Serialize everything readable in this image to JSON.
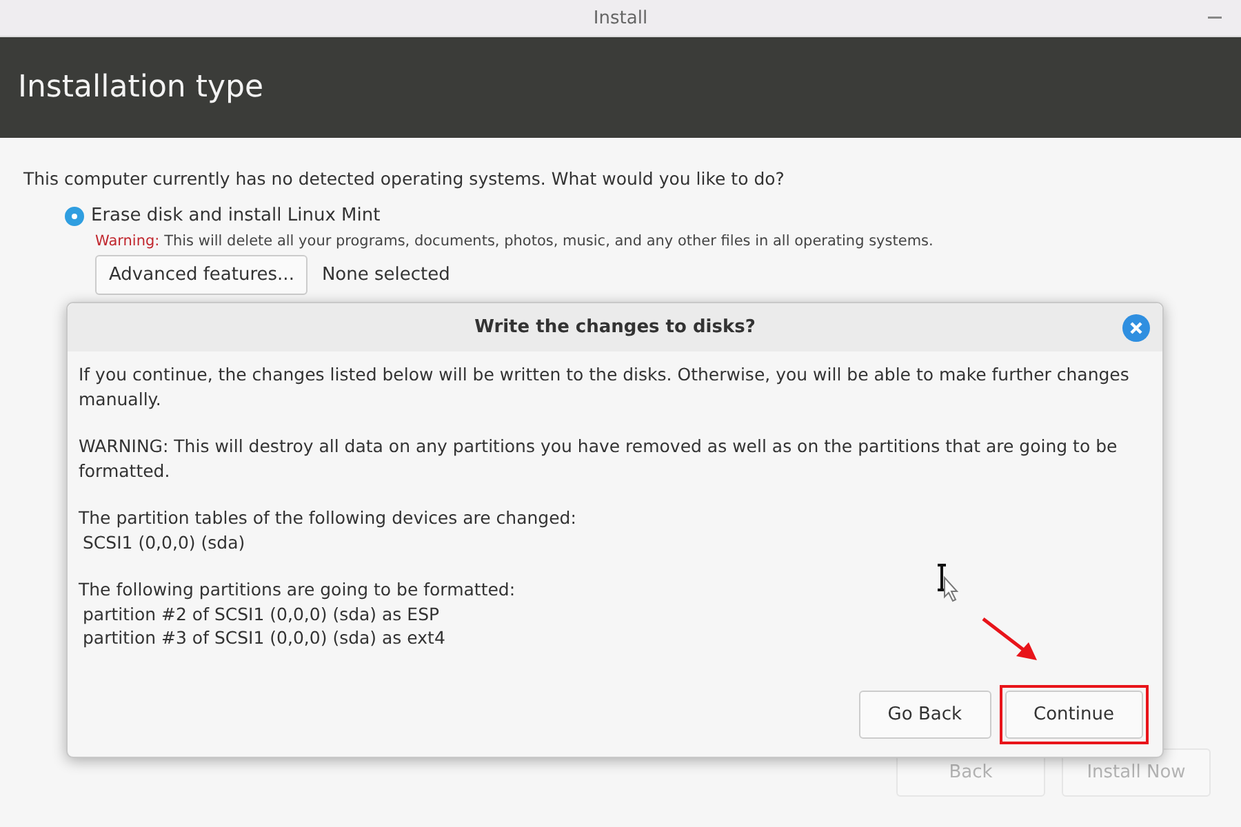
{
  "window": {
    "title": "Install"
  },
  "header": {
    "title": "Installation type"
  },
  "question": "This computer currently has no detected operating systems. What would you like to do?",
  "options": [
    {
      "label": "Erase disk and install Linux Mint",
      "selected": true,
      "warning_label": "Warning:",
      "warning_text": "This will delete all your programs, documents, photos, music, and any other files in all operating systems."
    }
  ],
  "advanced": {
    "button": "Advanced features...",
    "status": "None selected"
  },
  "footer_buttons": [
    {
      "label": "Back",
      "disabled": true
    },
    {
      "label": "Install Now",
      "disabled": true
    }
  ],
  "dialog": {
    "title": "Write the changes to disks?",
    "sections": [
      {
        "text": "If you continue, the changes listed below will be written to the disks. Otherwise, you will be able to make further changes manually."
      },
      {
        "text": "WARNING: This will destroy all data on any partitions you have removed as well as on the partitions that are going to be formatted."
      },
      {
        "text": "The partition tables of the following devices are changed:",
        "items": [
          "SCSI1 (0,0,0) (sda)"
        ]
      },
      {
        "text": "The following partitions are going to be formatted:",
        "items": [
          "partition #2 of SCSI1 (0,0,0) (sda) as ESP",
          "partition #3 of SCSI1 (0,0,0) (sda) as ext4"
        ]
      }
    ],
    "buttons": [
      {
        "label": "Go Back",
        "highlighted": false
      },
      {
        "label": "Continue",
        "highlighted": true
      }
    ]
  }
}
